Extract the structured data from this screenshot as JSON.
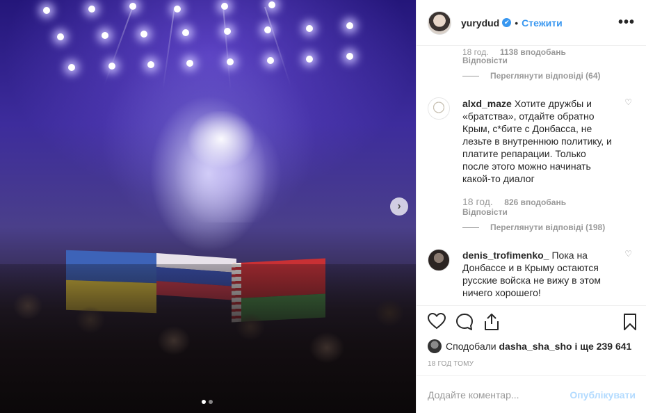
{
  "post": {
    "username": "yurydud",
    "separator": "•",
    "follow_label": "Стежити",
    "more_label": "•••",
    "verified_icon": "✔"
  },
  "comments": {
    "prev_meta_time": "18 год.",
    "prev_meta_likes": "1138 вподобань",
    "prev_reply": "Відповісти",
    "prev_view_replies": "Переглянути відповіді (64)",
    "items": [
      {
        "user": "alxd_maze",
        "text": "Хотите дружбы и «братства», отдайте обратно Крым, с*бите с Донбасса, не лезьте в внутреннюю политику, и платите репарации. Только после этого можно начинать какой-то диалог",
        "time": "18 год.",
        "likes": "826 вподобань",
        "reply": "Відповісти",
        "view_replies": "Переглянути відповіді (198)"
      },
      {
        "user": "denis_trofimenko_",
        "text": "Пока на Донбассе и в Крыму остаются русские войска не вижу в этом ничего хорошего!"
      }
    ]
  },
  "likes": {
    "prefix": "Сподобали",
    "user": "dasha_sha_sho",
    "suffix": "і ще 239 641"
  },
  "timestamp": "18 ГОД ТОМУ",
  "add_comment": {
    "placeholder": "Додайте коментар...",
    "post_label": "Опублікувати"
  },
  "colors": {
    "accent": "#3897f0",
    "post_disabled": "#b3dbff"
  },
  "icons": {
    "next": "›",
    "heart_small": "♡"
  },
  "carousel": {
    "count": 2,
    "active": 1
  }
}
